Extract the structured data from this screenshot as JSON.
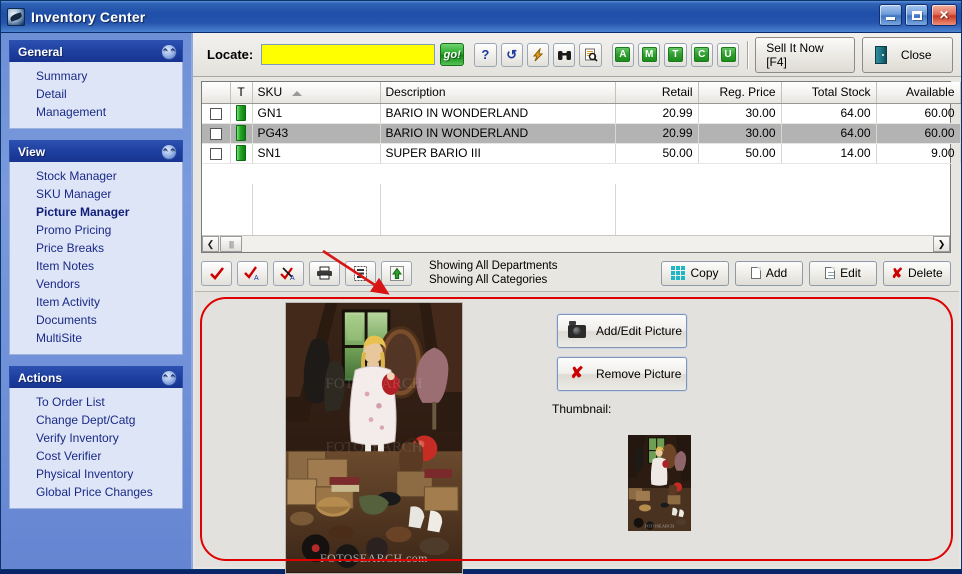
{
  "window": {
    "title": "Inventory Center",
    "icon": "app-icon",
    "buttons": {
      "minimize": "_",
      "maximize": "□",
      "close": "✕"
    }
  },
  "sidebar": {
    "groups": [
      {
        "title": "General",
        "collapse_icon": "chevron-up-icon",
        "items": [
          {
            "label": "Summary",
            "active": false
          },
          {
            "label": "Detail",
            "active": false
          },
          {
            "label": "Management",
            "active": false
          }
        ]
      },
      {
        "title": "View",
        "collapse_icon": "chevron-up-icon",
        "items": [
          {
            "label": "Stock Manager",
            "active": false
          },
          {
            "label": "SKU Manager",
            "active": false
          },
          {
            "label": "Picture Manager",
            "active": true
          },
          {
            "label": "Promo Pricing",
            "active": false
          },
          {
            "label": "Price Breaks",
            "active": false
          },
          {
            "label": "Item Notes",
            "active": false
          },
          {
            "label": "Vendors",
            "active": false
          },
          {
            "label": "Item Activity",
            "active": false
          },
          {
            "label": "Documents",
            "active": false
          },
          {
            "label": "MultiSite",
            "active": false
          }
        ]
      },
      {
        "title": "Actions",
        "collapse_icon": "chevron-up-icon",
        "items": [
          {
            "label": "To Order List",
            "active": false
          },
          {
            "label": "Change Dept/Catg",
            "active": false
          },
          {
            "label": "Verify Inventory",
            "active": false
          },
          {
            "label": "Cost Verifier",
            "active": false
          },
          {
            "label": "Physical Inventory",
            "active": false
          },
          {
            "label": "Global Price Changes",
            "active": false
          }
        ]
      }
    ]
  },
  "toolbar": {
    "locate_label": "Locate:",
    "locate_value": "",
    "locate_placeholder": "",
    "go_label": "go!",
    "icons": [
      {
        "name": "help-icon",
        "glyph": "?"
      },
      {
        "name": "refresh-icon",
        "glyph": "↺"
      },
      {
        "name": "lightning-icon",
        "glyph": "⚡"
      },
      {
        "name": "binoculars-icon",
        "glyph": "🔍"
      },
      {
        "name": "preview-icon",
        "glyph": "🔎"
      }
    ],
    "letter_filters": [
      "A",
      "M",
      "T",
      "C",
      "U"
    ],
    "sell_it_now": "Sell It Now [F4]",
    "close": "Close",
    "close_icon": "door-exit-icon"
  },
  "grid": {
    "columns": [
      {
        "label": "",
        "align": "c"
      },
      {
        "label": "T",
        "align": "c"
      },
      {
        "label": "SKU",
        "align": "l",
        "sorted": true
      },
      {
        "label": "Description",
        "align": "l"
      },
      {
        "label": "Retail",
        "align": "r"
      },
      {
        "label": "Reg. Price",
        "align": "r"
      },
      {
        "label": "Total Stock",
        "align": "r"
      },
      {
        "label": "Available",
        "align": "r"
      }
    ],
    "rows": [
      {
        "checked": false,
        "t": "green-flag-icon",
        "sku": "GN1",
        "description": "BARIO IN WONDERLAND",
        "retail": "20.99",
        "retail_red": true,
        "reg_price": "30.00",
        "total_stock": "64.00",
        "available": "60.00",
        "selected": false
      },
      {
        "checked": false,
        "t": "green-flag-icon",
        "sku": "PG43",
        "description": "BARIO IN WONDERLAND",
        "retail": "20.99",
        "retail_red": false,
        "reg_price": "30.00",
        "total_stock": "64.00",
        "available": "60.00",
        "selected": true
      },
      {
        "checked": false,
        "t": "green-flag-icon",
        "sku": "SN1",
        "description": "SUPER BARIO III",
        "retail": "50.00",
        "retail_red": false,
        "reg_price": "50.00",
        "total_stock": "14.00",
        "available": "9.00",
        "selected": false
      }
    ],
    "hscroll": {
      "left_glyph": "❮",
      "right_glyph": "❯"
    }
  },
  "actions": {
    "small_buttons": [
      {
        "name": "check-all-button",
        "glyph": "✔"
      },
      {
        "name": "check-all-alt-button",
        "glyph": "✔"
      },
      {
        "name": "uncheck-all-button",
        "glyph": "✘"
      },
      {
        "name": "print-button",
        "glyph": "🖶"
      },
      {
        "name": "list-button",
        "glyph": "▤"
      },
      {
        "name": "export-button",
        "glyph": "⬆"
      }
    ],
    "status_line_1": "Showing All Departments",
    "status_line_2": "Showing All Categories",
    "right_buttons": [
      {
        "label": "Copy",
        "icon": "copy-icon"
      },
      {
        "label": "Add",
        "icon": "add-page-icon"
      },
      {
        "label": "Edit",
        "icon": "edit-page-icon"
      },
      {
        "label": "Delete",
        "icon": "delete-x-icon"
      }
    ]
  },
  "picture_panel": {
    "add_edit_label": "Add/Edit Picture",
    "add_edit_icon": "camera-icon",
    "remove_label": "Remove Picture",
    "remove_icon": "remove-x-icon",
    "thumbnail_label": "Thumbnail:",
    "main_image_alt": "girl-in-attic-photo",
    "thumbnail_image_alt": "girl-in-attic-thumbnail",
    "watermark": "FOTOSEARCH.com"
  },
  "annotations": {
    "highlight_shape": "red-rounded-rectangle",
    "pointer": "red-arrow",
    "accent_color": "#e00000"
  }
}
